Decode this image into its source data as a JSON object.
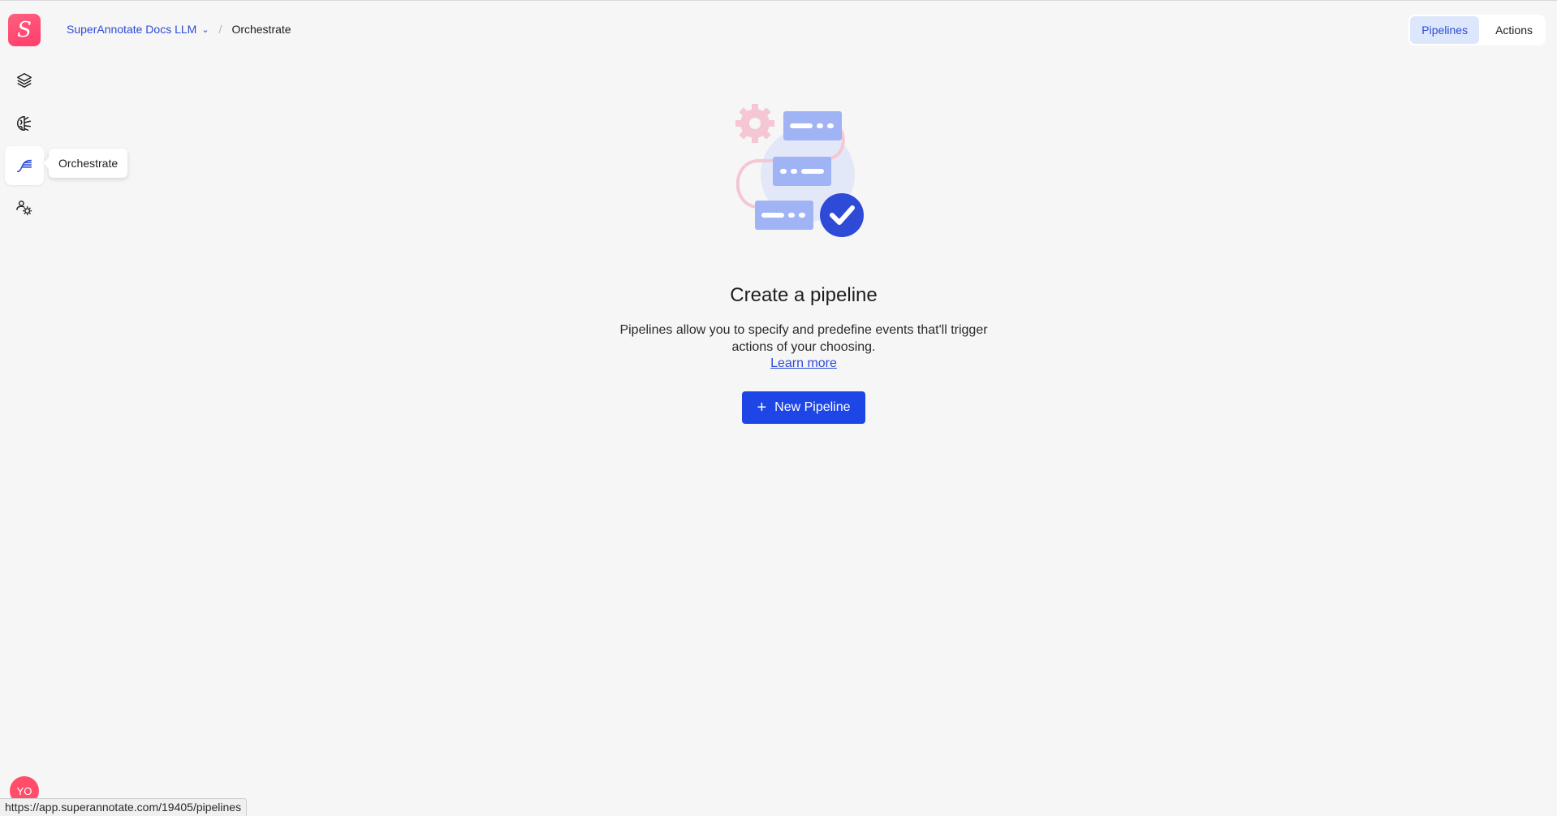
{
  "logo": {
    "letter": "S"
  },
  "sidebar": {
    "items": [
      {
        "name": "layers-icon"
      },
      {
        "name": "brain-icon"
      },
      {
        "name": "orchestrate-icon"
      },
      {
        "name": "team-settings-icon"
      }
    ],
    "tooltip": "Orchestrate"
  },
  "avatar": {
    "initials": "YO"
  },
  "breadcrumb": {
    "team": "SuperAnnotate Docs LLM",
    "separator": "/",
    "current": "Orchestrate"
  },
  "tabs": [
    {
      "label": "Pipelines",
      "selected": true
    },
    {
      "label": "Actions",
      "selected": false
    }
  ],
  "empty_state": {
    "title": "Create a pipeline",
    "description": "Pipelines allow you to specify and predefine events that'll trigger actions of your choosing.",
    "link": "Learn more",
    "button": "New Pipeline",
    "button_icon": "+"
  },
  "status_bar": {
    "url": "https://app.superannotate.com/19405/pipelines"
  },
  "colors": {
    "accent": "#1e46e6",
    "link": "#2d4bd6",
    "brand": "#ff3d6b",
    "tab_selected_bg": "#dde7fb"
  }
}
